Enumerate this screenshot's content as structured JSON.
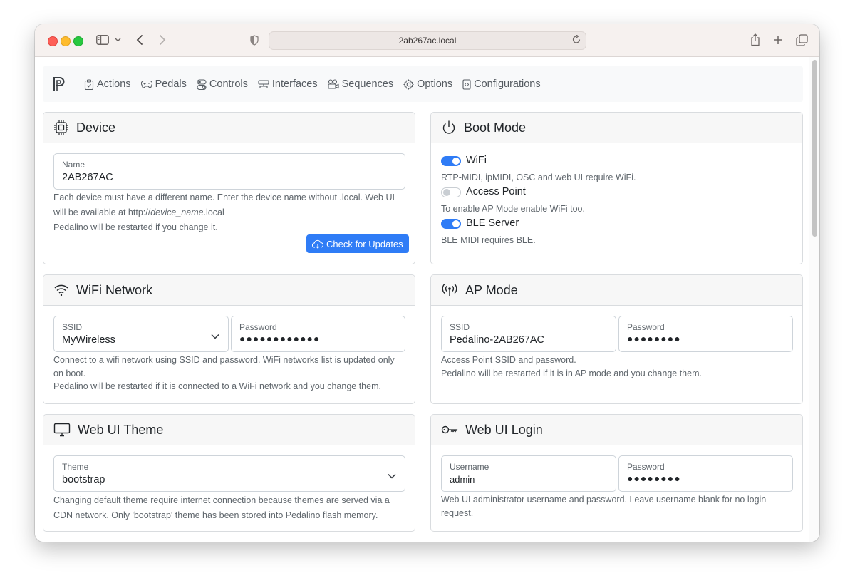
{
  "browser": {
    "url": "2ab267ac.local"
  },
  "nav": {
    "items": [
      {
        "label": "Actions"
      },
      {
        "label": "Pedals"
      },
      {
        "label": "Controls"
      },
      {
        "label": "Interfaces"
      },
      {
        "label": "Sequences"
      },
      {
        "label": "Options"
      },
      {
        "label": "Configurations"
      }
    ]
  },
  "device": {
    "title": "Device",
    "name_label": "Name",
    "name_value": "2AB267AC",
    "help_line1": "Each device must have a different name. Enter the device name without .local. Web UI",
    "help_line2_pre": "will be available at http://",
    "help_line2_em": "device_name",
    "help_line2_post": ".local",
    "help_line3": "Pedalino will be restarted if you change it.",
    "update_button": "Check for Updates"
  },
  "boot_mode": {
    "title": "Boot Mode",
    "wifi_label": "WiFi",
    "wifi_on": true,
    "wifi_help": "RTP-MIDI, ipMIDI, OSC and web UI require WiFi.",
    "ap_label": "Access Point",
    "ap_on": false,
    "ap_help": "To enable AP Mode enable WiFi too.",
    "ble_label": "BLE Server",
    "ble_on": true,
    "ble_help": "BLE MIDI requires BLE."
  },
  "wifi_network": {
    "title": "WiFi Network",
    "ssid_label": "SSID",
    "ssid_value": "MyWireless",
    "password_label": "Password",
    "password_value": "●●●●●●●●●●●●",
    "help_line1": "Connect to a wifi network using SSID and password. WiFi networks list is updated only",
    "help_line2": "on boot.",
    "help_line3": "Pedalino will be restarted if it is connected to a WiFi network and you change them."
  },
  "ap_mode": {
    "title": "AP Mode",
    "ssid_label": "SSID",
    "ssid_value": "Pedalino-2AB267AC",
    "password_label": "Password",
    "password_value": "●●●●●●●●",
    "help_line1": "Access Point SSID and password.",
    "help_line2": "Pedalino will be restarted if it is in AP mode and you change them."
  },
  "web_ui_theme": {
    "title": "Web UI Theme",
    "theme_label": "Theme",
    "theme_value": "bootstrap",
    "help_line1": "Changing default theme require internet connection because themes are served via a",
    "help_line2": "CDN network. Only 'bootstrap' theme has been stored into Pedalino flash memory."
  },
  "web_ui_login": {
    "title": "Web UI Login",
    "username_label": "Username",
    "username_value": "admin",
    "password_label": "Password",
    "password_value": "●●●●●●●●",
    "help_line1": "Web UI administrator username and password. Leave username blank for no login",
    "help_line2": "request."
  },
  "colors": {
    "primary": "#2f7cf6",
    "card_header_bg": "#f7f7f7",
    "navbar_bg": "#f8f9fa"
  }
}
